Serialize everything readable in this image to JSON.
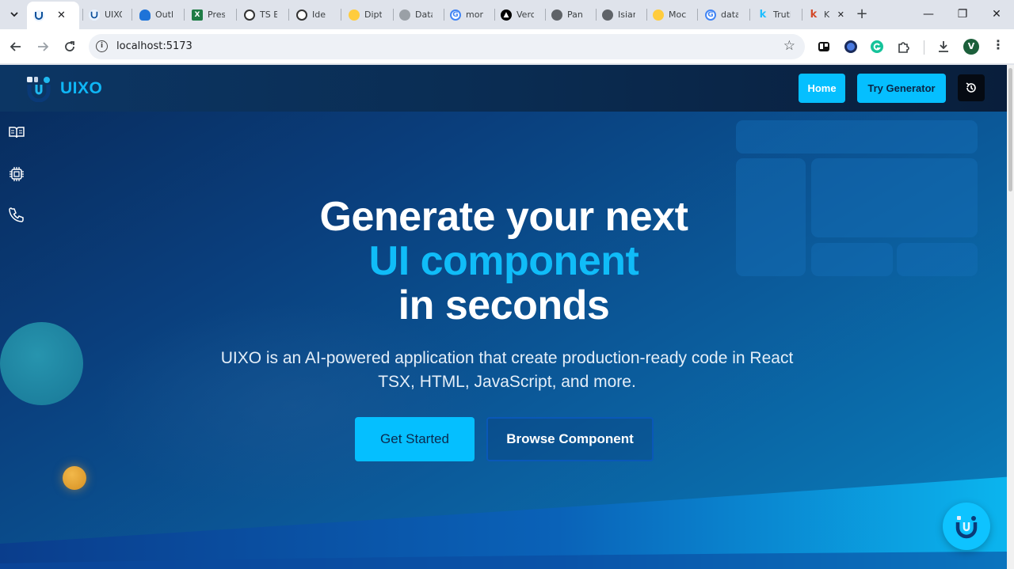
{
  "browser": {
    "tabs": [
      {
        "label": "",
        "favicon": "uixo-icon",
        "active": true
      },
      {
        "label": "UIXO",
        "favicon": "uixo-icon"
      },
      {
        "label": "Outlook",
        "favicon": "onedrive-icon"
      },
      {
        "label": "Pres",
        "favicon": "excel-icon"
      },
      {
        "label": "TS E",
        "favicon": "openai-icon"
      },
      {
        "label": "Ide",
        "favicon": "openai-icon"
      },
      {
        "label": "Dipt",
        "favicon": "huggingface-icon"
      },
      {
        "label": "Data",
        "favicon": "perplexity-icon"
      },
      {
        "label": "mor",
        "favicon": "google-icon"
      },
      {
        "label": "Verc",
        "favicon": "vercel-icon"
      },
      {
        "label": "Pan",
        "favicon": "globe-icon"
      },
      {
        "label": "Isiar",
        "favicon": "globe-icon"
      },
      {
        "label": "Moc",
        "favicon": "huggingface-icon"
      },
      {
        "label": "data",
        "favicon": "google-icon"
      },
      {
        "label": "Truti",
        "favicon": "kaggle-icon"
      },
      {
        "label": "Kag",
        "favicon": "kaggle-icon"
      }
    ],
    "close_glyph": "✕",
    "new_tab_glyph": "+",
    "window_controls": {
      "minimize": "—",
      "maximize": "❐",
      "close": "✕"
    },
    "url": "localhost:5173",
    "profile_initial": "V"
  },
  "navbar": {
    "brand": "UIXO",
    "home_label": "Home",
    "try_label": "Try Generator"
  },
  "sidebar": {
    "icons": [
      "book-icon",
      "chip-icon",
      "phone-icon"
    ]
  },
  "hero": {
    "line1": "Generate your next",
    "line2": "UI component",
    "line3": "in seconds",
    "subtitle": "UIXO is an AI-powered application that create production-ready code in React TSX, HTML, JavaScript, and more.",
    "cta_primary": "Get Started",
    "cta_secondary": "Browse Component"
  },
  "colors": {
    "accent": "#05bfff",
    "brand_text": "#0fb6f5",
    "headline_highlight": "#10bcf8",
    "page_bg_dark": "#082a5a",
    "page_bg_light": "#0b84c2"
  }
}
